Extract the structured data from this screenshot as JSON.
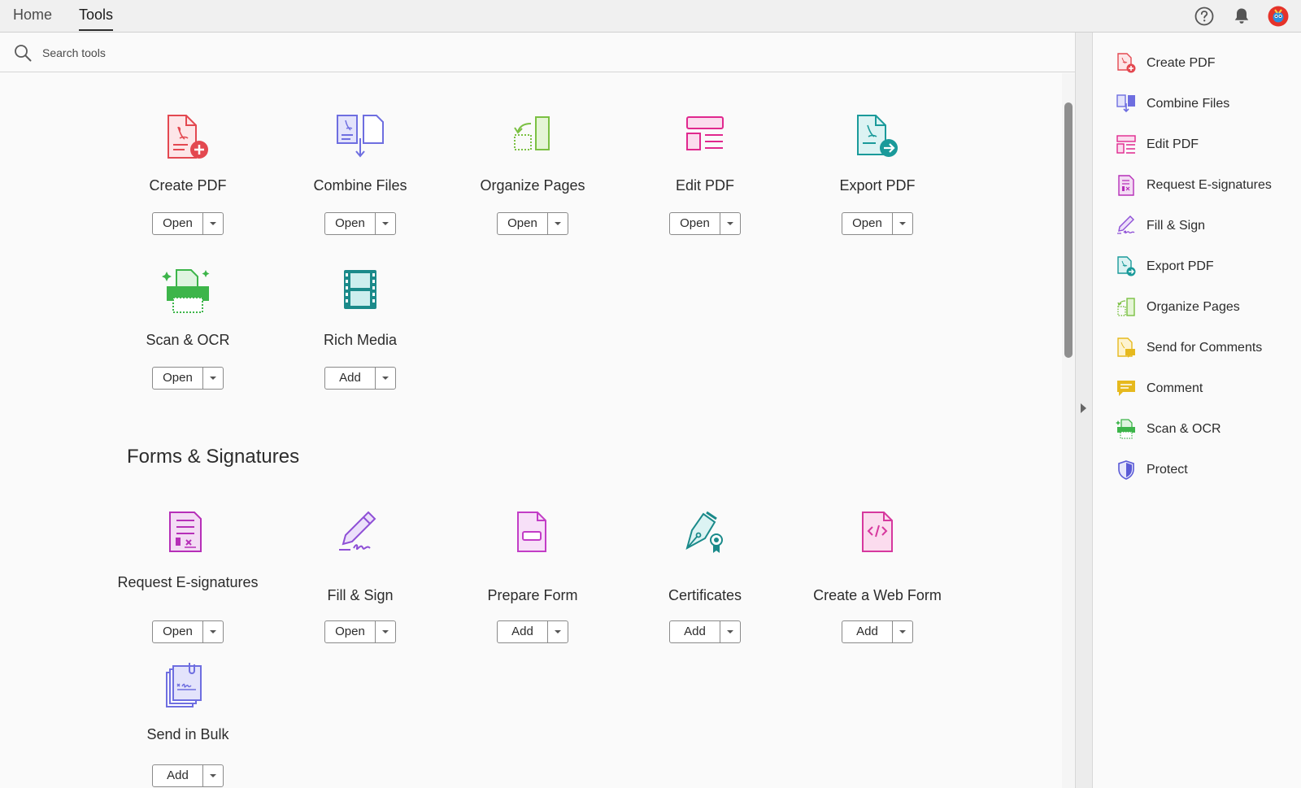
{
  "nav": {
    "home": "Home",
    "tools": "Tools"
  },
  "header_icons": [
    "help-icon",
    "bell-icon",
    "avatar"
  ],
  "search": {
    "placeholder": "Search tools",
    "icon": "search-icon"
  },
  "tools": [
    {
      "label": "Create PDF",
      "button": "Open",
      "color": "#e34850"
    },
    {
      "label": "Combine Files",
      "button": "Open",
      "color": "#6e6ee0"
    },
    {
      "label": "Organize Pages",
      "button": "Open",
      "color": "#7bc043"
    },
    {
      "label": "Edit PDF",
      "button": "Open",
      "color": "#e0288e"
    },
    {
      "label": "Export PDF",
      "button": "Open",
      "color": "#1a9a9a"
    },
    {
      "label": "Scan & OCR",
      "button": "Open",
      "color": "#3db54a"
    },
    {
      "label": "Rich Media",
      "button": "Add",
      "color": "#1b8a8a"
    }
  ],
  "forms_section": {
    "title": "Forms & Signatures",
    "tools": [
      {
        "label": "Request E-signatures",
        "button": "Open",
        "color": "#b62fb8"
      },
      {
        "label": "Fill & Sign",
        "button": "Open",
        "color": "#8e4fd6"
      },
      {
        "label": "Prepare Form",
        "button": "Add",
        "color": "#c23dc6"
      },
      {
        "label": "Certificates",
        "button": "Add",
        "color": "#1a8a8a"
      },
      {
        "label": "Create a Web Form",
        "button": "Add",
        "color": "#d6389e"
      },
      {
        "label": "Send in Bulk",
        "button": "Add",
        "color": "#6e6ee0"
      }
    ]
  },
  "right_pane": [
    {
      "label": "Create PDF",
      "icon": "create-pdf-icon",
      "color": "#e34850"
    },
    {
      "label": "Combine Files",
      "icon": "combine-files-icon",
      "color": "#6e6ee0"
    },
    {
      "label": "Edit PDF",
      "icon": "edit-pdf-icon",
      "color": "#e0288e"
    },
    {
      "label": "Request E-signatures",
      "icon": "request-esignatures-icon",
      "color": "#b62fb8"
    },
    {
      "label": "Fill & Sign",
      "icon": "fill-sign-icon",
      "color": "#8e4fd6"
    },
    {
      "label": "Export PDF",
      "icon": "export-pdf-icon",
      "color": "#1a9a9a"
    },
    {
      "label": "Organize Pages",
      "icon": "organize-pages-icon",
      "color": "#7bc043"
    },
    {
      "label": "Send for Comments",
      "icon": "send-for-comments-icon",
      "color": "#e6b91e"
    },
    {
      "label": "Comment",
      "icon": "comment-icon",
      "color": "#e6b91e"
    },
    {
      "label": "Scan & OCR",
      "icon": "scan-ocr-icon",
      "color": "#3db54a"
    },
    {
      "label": "Protect",
      "icon": "protect-icon",
      "color": "#5a5ad6"
    }
  ]
}
